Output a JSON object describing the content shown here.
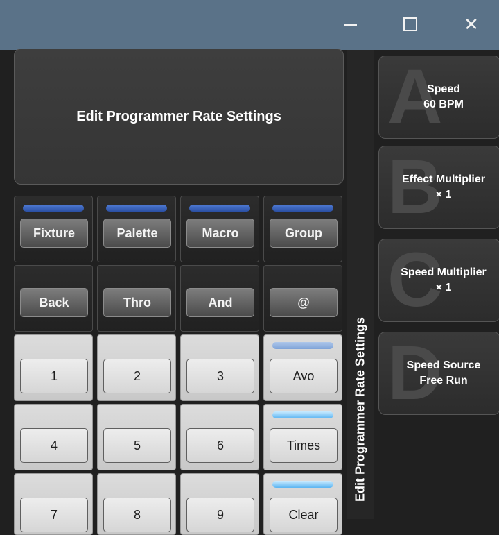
{
  "window": {
    "minimize_glyph": "—",
    "maximize_glyph": "☐",
    "close_glyph": "✕"
  },
  "header": {
    "title": "Edit Programmer Rate Settings"
  },
  "keypad": {
    "row1": [
      {
        "label": "Fixture",
        "indicator": "blue"
      },
      {
        "label": "Palette",
        "indicator": "blue"
      },
      {
        "label": "Macro",
        "indicator": "blue"
      },
      {
        "label": "Group",
        "indicator": "blue"
      }
    ],
    "row2": [
      {
        "label": "Back"
      },
      {
        "label": "Thro"
      },
      {
        "label": "And"
      },
      {
        "label": "@"
      }
    ],
    "row3": [
      {
        "label": "1"
      },
      {
        "label": "2"
      },
      {
        "label": "3"
      },
      {
        "label": "Avo",
        "indicator": "pale"
      }
    ],
    "row4": [
      {
        "label": "4"
      },
      {
        "label": "5"
      },
      {
        "label": "6"
      },
      {
        "label": "Times",
        "indicator": "sky"
      }
    ],
    "row5": [
      {
        "label": "7"
      },
      {
        "label": "8"
      },
      {
        "label": "9"
      },
      {
        "label": "Clear",
        "indicator": "sky"
      }
    ]
  },
  "side_title": "Edit Programmer Rate Settings",
  "softkeys": [
    {
      "letter": "A",
      "line1": "Speed",
      "line2": "60 BPM"
    },
    {
      "letter": "B",
      "line1": "Effect Multiplier",
      "line2": "× 1"
    },
    {
      "letter": "C",
      "line1": "Speed Multiplier",
      "line2": "× 1"
    },
    {
      "letter": "D",
      "line1": "Speed Source",
      "line2": "Free Run"
    }
  ],
  "colors": {
    "titlebar": "#5a7288",
    "indicator_blue": "#2a4fa3",
    "indicator_sky": "#5bb5f2"
  }
}
